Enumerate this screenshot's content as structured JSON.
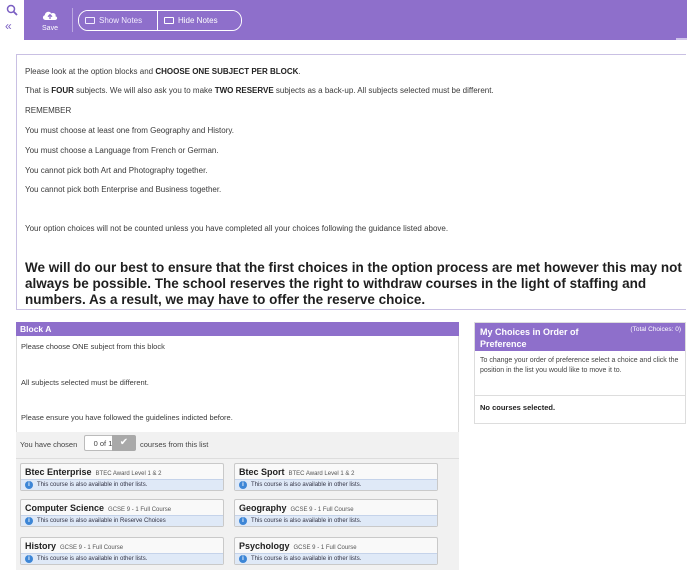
{
  "toolbar": {
    "save_label": "Save",
    "show_notes_label": "Show Notes",
    "hide_notes_label": "Hide Notes",
    "collapse_glyph": "«"
  },
  "instructions": {
    "line1_prefix": "Please look at the option blocks and ",
    "line1_bold": "CHOOSE ONE SUBJECT PER BLOCK",
    "line1_suffix": ".",
    "line2_prefix": "That is ",
    "line2_bold1": "FOUR",
    "line2_mid": " subjects.  We will also ask you to make ",
    "line2_bold2": "TWO RESERVE",
    "line2_suffix": " subjects as a back-up.  All subjects selected must be different.",
    "remember": "REMEMBER",
    "rule1": "You must choose at least one from Geography and History.",
    "rule2": "You must choose a Language from French or German.",
    "rule3": "You cannot pick both Art and Photography together.",
    "rule4": "You cannot pick both Enterprise and Business together.",
    "warning": "Your option choices will not be counted unless you have completed all your choices following the guidance listed above.",
    "notice": "We will do our best to ensure that the first choices in the option process are met however this may not always be possible.  The school reserves the right to withdraw courses in the light of staffing and numbers.  As a result, we may have to offer the reserve choice."
  },
  "block_a": {
    "title": "Block A",
    "line1": "Please choose ONE subject from this block",
    "line2": "All subjects selected must be different.",
    "line3": "Please ensure you have followed the guidelines indicted before.",
    "chosen_prefix": "You have chosen",
    "chosen_count": "0 of 1",
    "chosen_suffix": "courses from this list",
    "courses": [
      {
        "name": "Btec Enterprise",
        "qual": "BTEC Award Level 1 & 2",
        "note": "This course is also available in other lists."
      },
      {
        "name": "Btec Sport",
        "qual": "BTEC Award Level 1 & 2",
        "note": "This course is also available in other lists."
      },
      {
        "name": "Computer Science",
        "qual": "GCSE 9 - 1 Full Course",
        "note": "This course is also available in Reserve Choices"
      },
      {
        "name": "Geography",
        "qual": "GCSE 9 - 1 Full Course",
        "note": "This course is also available in other lists."
      },
      {
        "name": "History",
        "qual": "GCSE 9 - 1 Full Course",
        "note": "This course is also available in other lists."
      },
      {
        "name": "Psychology",
        "qual": "GCSE 9 - 1 Full Course",
        "note": "This course is also available in other lists."
      }
    ]
  },
  "choices": {
    "title": "My Choices in Order of Preference",
    "total": "(Total Choices: 0)",
    "help": "To change your order of preference select a choice and click the position in the list you would like to move it to.",
    "empty": "No courses selected."
  },
  "colors": {
    "accent": "#8e6fcb",
    "info_blue": "#3d86d6",
    "note_bg": "#dfe9f7"
  }
}
